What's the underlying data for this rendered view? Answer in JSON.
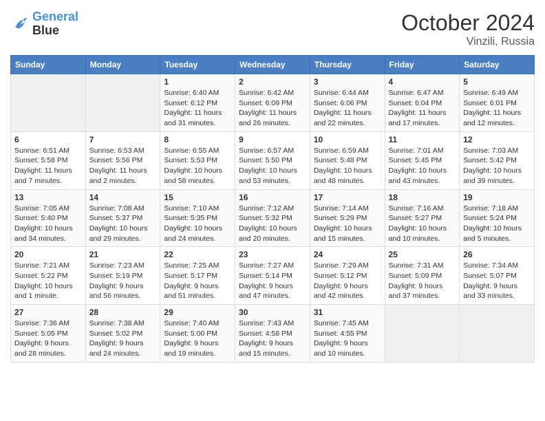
{
  "logo": {
    "line1": "General",
    "line2": "Blue"
  },
  "title": "October 2024",
  "subtitle": "Vinzili, Russia",
  "days_header": [
    "Sunday",
    "Monday",
    "Tuesday",
    "Wednesday",
    "Thursday",
    "Friday",
    "Saturday"
  ],
  "weeks": [
    [
      {
        "day": "",
        "info": ""
      },
      {
        "day": "",
        "info": ""
      },
      {
        "day": "1",
        "info": "Sunrise: 6:40 AM\nSunset: 6:12 PM\nDaylight: 11 hours and 31 minutes."
      },
      {
        "day": "2",
        "info": "Sunrise: 6:42 AM\nSunset: 6:09 PM\nDaylight: 11 hours and 26 minutes."
      },
      {
        "day": "3",
        "info": "Sunrise: 6:44 AM\nSunset: 6:06 PM\nDaylight: 11 hours and 22 minutes."
      },
      {
        "day": "4",
        "info": "Sunrise: 6:47 AM\nSunset: 6:04 PM\nDaylight: 11 hours and 17 minutes."
      },
      {
        "day": "5",
        "info": "Sunrise: 6:49 AM\nSunset: 6:01 PM\nDaylight: 11 hours and 12 minutes."
      }
    ],
    [
      {
        "day": "6",
        "info": "Sunrise: 6:51 AM\nSunset: 5:58 PM\nDaylight: 11 hours and 7 minutes."
      },
      {
        "day": "7",
        "info": "Sunrise: 6:53 AM\nSunset: 5:56 PM\nDaylight: 11 hours and 2 minutes."
      },
      {
        "day": "8",
        "info": "Sunrise: 6:55 AM\nSunset: 5:53 PM\nDaylight: 10 hours and 58 minutes."
      },
      {
        "day": "9",
        "info": "Sunrise: 6:57 AM\nSunset: 5:50 PM\nDaylight: 10 hours and 53 minutes."
      },
      {
        "day": "10",
        "info": "Sunrise: 6:59 AM\nSunset: 5:48 PM\nDaylight: 10 hours and 48 minutes."
      },
      {
        "day": "11",
        "info": "Sunrise: 7:01 AM\nSunset: 5:45 PM\nDaylight: 10 hours and 43 minutes."
      },
      {
        "day": "12",
        "info": "Sunrise: 7:03 AM\nSunset: 5:42 PM\nDaylight: 10 hours and 39 minutes."
      }
    ],
    [
      {
        "day": "13",
        "info": "Sunrise: 7:05 AM\nSunset: 5:40 PM\nDaylight: 10 hours and 34 minutes."
      },
      {
        "day": "14",
        "info": "Sunrise: 7:08 AM\nSunset: 5:37 PM\nDaylight: 10 hours and 29 minutes."
      },
      {
        "day": "15",
        "info": "Sunrise: 7:10 AM\nSunset: 5:35 PM\nDaylight: 10 hours and 24 minutes."
      },
      {
        "day": "16",
        "info": "Sunrise: 7:12 AM\nSunset: 5:32 PM\nDaylight: 10 hours and 20 minutes."
      },
      {
        "day": "17",
        "info": "Sunrise: 7:14 AM\nSunset: 5:29 PM\nDaylight: 10 hours and 15 minutes."
      },
      {
        "day": "18",
        "info": "Sunrise: 7:16 AM\nSunset: 5:27 PM\nDaylight: 10 hours and 10 minutes."
      },
      {
        "day": "19",
        "info": "Sunrise: 7:18 AM\nSunset: 5:24 PM\nDaylight: 10 hours and 5 minutes."
      }
    ],
    [
      {
        "day": "20",
        "info": "Sunrise: 7:21 AM\nSunset: 5:22 PM\nDaylight: 10 hours and 1 minute."
      },
      {
        "day": "21",
        "info": "Sunrise: 7:23 AM\nSunset: 5:19 PM\nDaylight: 9 hours and 56 minutes."
      },
      {
        "day": "22",
        "info": "Sunrise: 7:25 AM\nSunset: 5:17 PM\nDaylight: 9 hours and 51 minutes."
      },
      {
        "day": "23",
        "info": "Sunrise: 7:27 AM\nSunset: 5:14 PM\nDaylight: 9 hours and 47 minutes."
      },
      {
        "day": "24",
        "info": "Sunrise: 7:29 AM\nSunset: 5:12 PM\nDaylight: 9 hours and 42 minutes."
      },
      {
        "day": "25",
        "info": "Sunrise: 7:31 AM\nSunset: 5:09 PM\nDaylight: 9 hours and 37 minutes."
      },
      {
        "day": "26",
        "info": "Sunrise: 7:34 AM\nSunset: 5:07 PM\nDaylight: 9 hours and 33 minutes."
      }
    ],
    [
      {
        "day": "27",
        "info": "Sunrise: 7:36 AM\nSunset: 5:05 PM\nDaylight: 9 hours and 28 minutes."
      },
      {
        "day": "28",
        "info": "Sunrise: 7:38 AM\nSunset: 5:02 PM\nDaylight: 9 hours and 24 minutes."
      },
      {
        "day": "29",
        "info": "Sunrise: 7:40 AM\nSunset: 5:00 PM\nDaylight: 9 hours and 19 minutes."
      },
      {
        "day": "30",
        "info": "Sunrise: 7:43 AM\nSunset: 4:58 PM\nDaylight: 9 hours and 15 minutes."
      },
      {
        "day": "31",
        "info": "Sunrise: 7:45 AM\nSunset: 4:55 PM\nDaylight: 9 hours and 10 minutes."
      },
      {
        "day": "",
        "info": ""
      },
      {
        "day": "",
        "info": ""
      }
    ]
  ]
}
